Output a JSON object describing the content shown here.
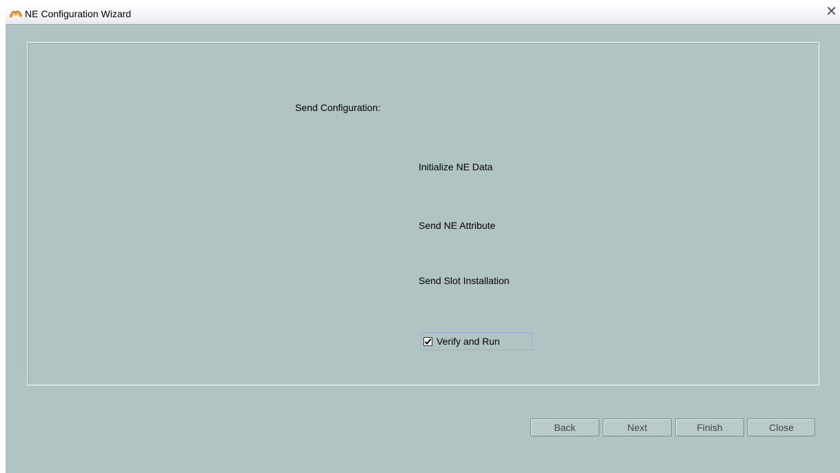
{
  "window": {
    "title": "NE Configuration Wizard",
    "icon": "app-logo-icon",
    "close_glyph": "✕"
  },
  "main": {
    "heading": "Send Configuration:",
    "steps": [
      "Initialize NE Data",
      "Send NE Attribute",
      "Send Slot Installation"
    ],
    "verify_checkbox": {
      "label": "Verify and Run",
      "checked": true
    }
  },
  "footer": {
    "back_label": "Back",
    "next_label": "Next",
    "finish_label": "Finish",
    "close_label": "Close"
  },
  "colors": {
    "background": "#b0c4c4",
    "titlebar": "#eef1f5",
    "button_text_disabled": "#444444"
  }
}
